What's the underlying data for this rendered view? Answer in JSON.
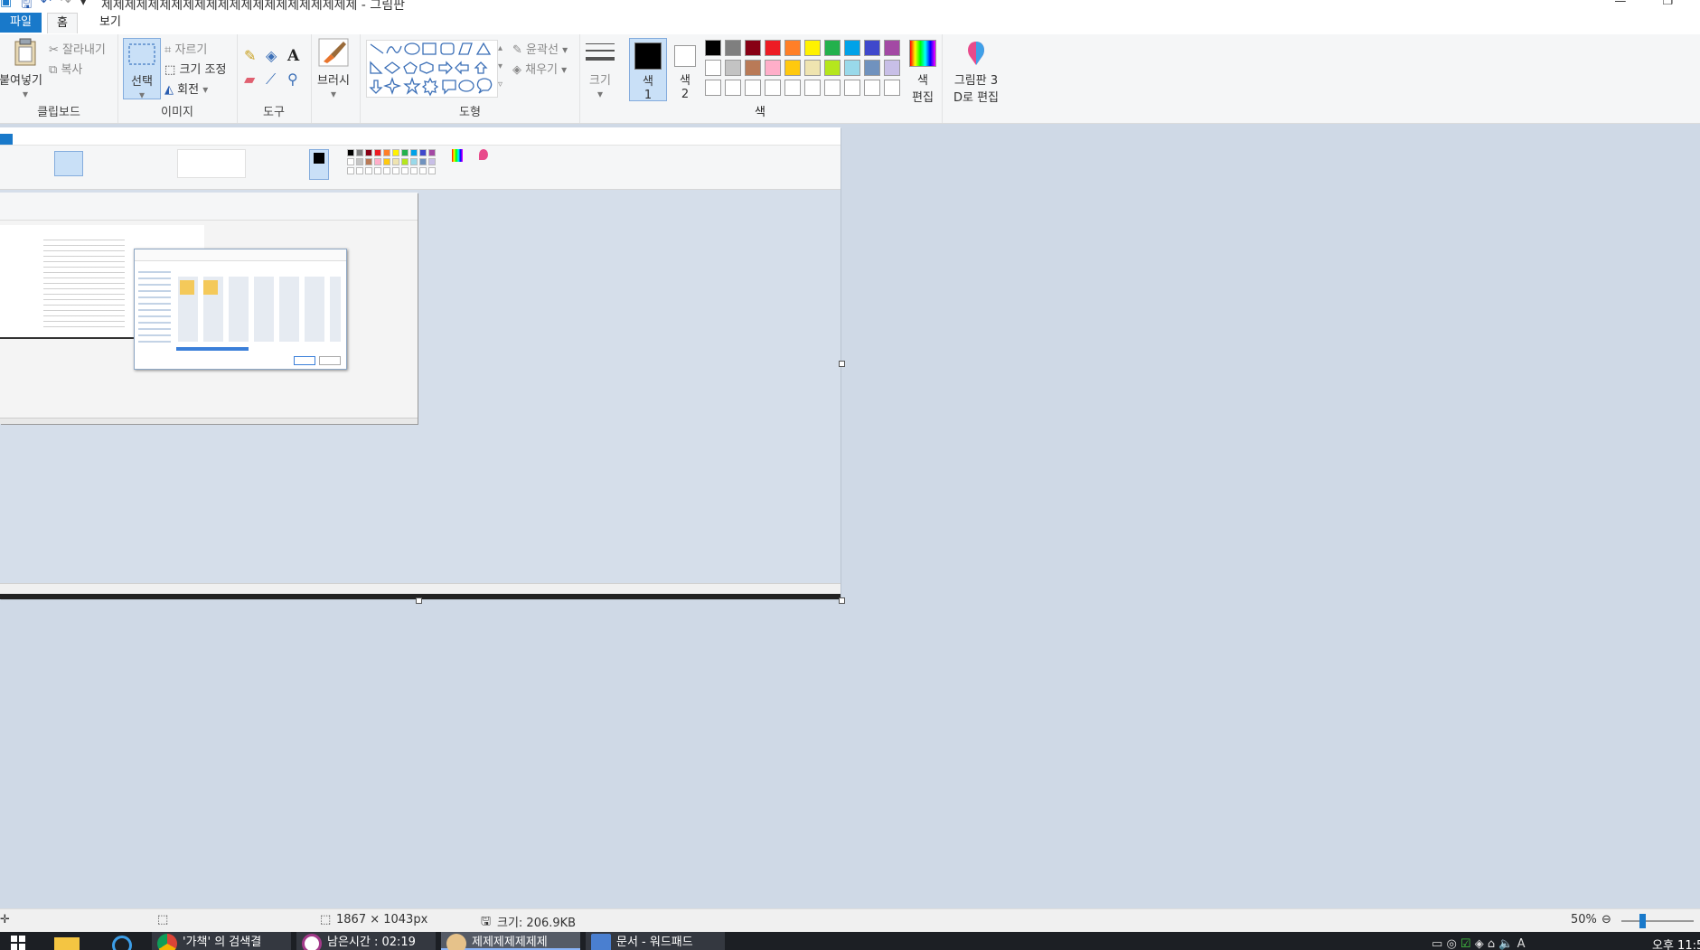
{
  "window": {
    "title": "제제제제제제제제제제제제제제제제제제제제제제 - 그림판",
    "minimize": "—",
    "restore": "❐"
  },
  "menu": {
    "file": "파일",
    "home": "홈",
    "view": "보기"
  },
  "ribbon": {
    "clipboard": {
      "label": "클립보드",
      "paste": "붙여넣기",
      "cut": "잘라내기",
      "copy": "복사"
    },
    "image": {
      "label": "이미지",
      "select": "선택",
      "crop": "자르기",
      "resize": "크기 조정",
      "rotate": "회전"
    },
    "tools": {
      "label": "도구"
    },
    "brushes": {
      "label": "브러시"
    },
    "shapes": {
      "label": "도형",
      "outline": "윤곽선",
      "fill": "채우기"
    },
    "size": {
      "label": "크기"
    },
    "color1": {
      "label1": "색",
      "label2": "1"
    },
    "color2": {
      "label1": "색",
      "label2": "2"
    },
    "colors": {
      "label": "색",
      "edit1": "색",
      "edit2": "편집"
    },
    "paint3d": {
      "line1": "그림판 3",
      "line2": "D로 편집"
    }
  },
  "palette": {
    "row1": [
      "#000000",
      "#7f7f7f",
      "#880015",
      "#ed1c24",
      "#ff7f27",
      "#fff200",
      "#22b14c",
      "#00a2e8",
      "#3f48cc",
      "#a349a4"
    ],
    "row2": [
      "#ffffff",
      "#c3c3c3",
      "#b97a57",
      "#ffaec9",
      "#ffc90e",
      "#efe4b0",
      "#b5e61d",
      "#99d9ea",
      "#7092be",
      "#c8bfe7"
    ],
    "row3": [
      "#ffffff",
      "#ffffff",
      "#ffffff",
      "#ffffff",
      "#ffffff",
      "#ffffff",
      "#ffffff",
      "#ffffff",
      "#ffffff",
      "#ffffff"
    ]
  },
  "status": {
    "dimensions": "1867 × 1043px",
    "size": "크기: 206.9KB",
    "zoom": "50%"
  },
  "taskbar": {
    "chrome": "'가책' 의 검색결",
    "app2": "남은시간 : 02:19",
    "paint": "제제제제제제제",
    "notepad": "문서 - 워드패드",
    "clock": "오후 11:5"
  }
}
